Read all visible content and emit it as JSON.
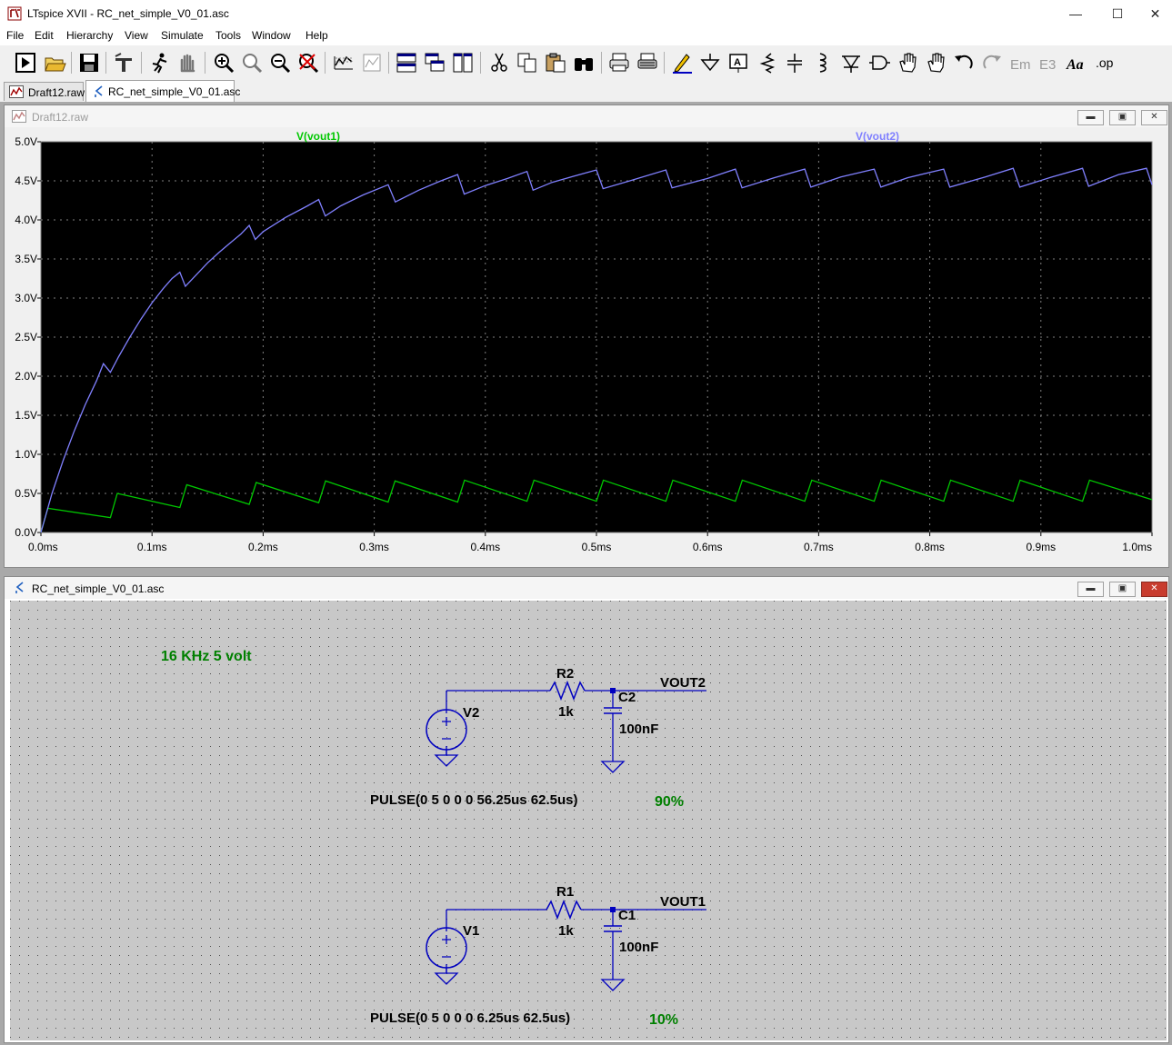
{
  "window": {
    "title": "LTspice XVII - RC_net_simple_V0_01.asc"
  },
  "menu": [
    "File",
    "Edit",
    "Hierarchy",
    "View",
    "Simulate",
    "Tools",
    "Window",
    "Help"
  ],
  "toolbar_icons": [
    "run-icon",
    "open-icon",
    "save-icon",
    "control-panel-icon",
    "run-man-icon",
    "halt-icon",
    "zoom-in-icon",
    "zoom-fit-icon",
    "zoom-out-icon",
    "zoom-cancel-icon",
    "autorange-icon",
    "pick-traces-icon",
    "tile-horizontal-icon",
    "cascade-icon",
    "tile-vertical-icon",
    "cut-icon",
    "copy-icon",
    "paste-icon",
    "find-icon",
    "print-icon",
    "print-setup-icon",
    "draw-wire-icon",
    "ground-icon",
    "label-net-icon",
    "resistor-icon",
    "capacitor-icon",
    "inductor-icon",
    "diode-icon",
    "component-icon",
    "move-icon",
    "drag-icon",
    "undo-icon",
    "redo-icon",
    "rotate-icon",
    "mirror-icon",
    "text-icon",
    "spice-directive-icon"
  ],
  "tabs": [
    {
      "label": "Draft12.raw",
      "icon": "waveform-icon"
    },
    {
      "label": "RC_net_simple_V0_01.asc",
      "icon": "schematic-icon"
    }
  ],
  "plot_window": {
    "title": "Draft12.raw"
  },
  "schematic_window": {
    "title": "RC_net_simple_V0_01.asc"
  },
  "colors": {
    "vout1": "#00c800",
    "vout2": "#8080ff",
    "schem_text": "#000000",
    "note_green": "#008000",
    "wire": "#0000c0"
  },
  "chart_data": {
    "type": "line",
    "title": "",
    "xlabel": "",
    "ylabel": "",
    "xlim": [
      0,
      1.0
    ],
    "ylim": [
      0,
      5.0
    ],
    "grid": true,
    "background": "#000000",
    "x_ticks": [
      "0.0ms",
      "0.1ms",
      "0.2ms",
      "0.3ms",
      "0.4ms",
      "0.5ms",
      "0.6ms",
      "0.7ms",
      "0.8ms",
      "0.9ms",
      "1.0ms"
    ],
    "y_ticks": [
      "0.0V",
      "0.5V",
      "1.0V",
      "1.5V",
      "2.0V",
      "2.5V",
      "3.0V",
      "3.5V",
      "4.0V",
      "4.5V",
      "5.0V"
    ],
    "series": [
      {
        "name": "V(vout1)",
        "color": "#00c800",
        "x": [
          0,
          0.00625,
          0.0625,
          0.06875,
          0.125,
          0.13125,
          0.1875,
          0.19375,
          0.25,
          0.25625,
          0.3125,
          0.31875,
          0.375,
          0.38125,
          0.4375,
          0.44375,
          0.5,
          0.50625,
          0.5625,
          0.56875,
          0.625,
          0.63125,
          0.6875,
          0.69375,
          0.75,
          0.75625,
          0.8125,
          0.81875,
          0.875,
          0.88125,
          0.9375,
          0.94375,
          1.0
        ],
        "y": [
          0,
          0.31,
          0.19,
          0.5,
          0.32,
          0.61,
          0.36,
          0.64,
          0.38,
          0.66,
          0.39,
          0.66,
          0.39,
          0.67,
          0.4,
          0.67,
          0.4,
          0.67,
          0.4,
          0.67,
          0.4,
          0.67,
          0.4,
          0.67,
          0.4,
          0.67,
          0.4,
          0.67,
          0.4,
          0.67,
          0.4,
          0.67,
          0.42
        ]
      },
      {
        "name": "V(vout2)",
        "color": "#8080ff",
        "x": [
          0,
          0.01,
          0.02,
          0.03,
          0.04,
          0.05,
          0.05625,
          0.0625,
          0.07,
          0.08,
          0.09,
          0.1,
          0.11,
          0.118,
          0.125,
          0.13,
          0.14,
          0.15,
          0.16,
          0.17,
          0.18,
          0.1875,
          0.193,
          0.2,
          0.22,
          0.24,
          0.25,
          0.256,
          0.27,
          0.29,
          0.3125,
          0.319,
          0.34,
          0.36,
          0.375,
          0.381,
          0.4,
          0.42,
          0.4375,
          0.443,
          0.46,
          0.48,
          0.5,
          0.506,
          0.53,
          0.5625,
          0.568,
          0.6,
          0.625,
          0.631,
          0.66,
          0.6875,
          0.693,
          0.72,
          0.75,
          0.756,
          0.78,
          0.8125,
          0.818,
          0.85,
          0.875,
          0.881,
          0.91,
          0.9375,
          0.943,
          0.97,
          0.995,
          1.0
        ],
        "y": [
          0,
          0.5,
          0.92,
          1.3,
          1.64,
          1.94,
          2.16,
          2.05,
          2.25,
          2.5,
          2.73,
          2.94,
          3.12,
          3.25,
          3.33,
          3.15,
          3.3,
          3.45,
          3.58,
          3.7,
          3.82,
          3.93,
          3.75,
          3.85,
          4.03,
          4.18,
          4.26,
          4.05,
          4.18,
          4.32,
          4.45,
          4.23,
          4.38,
          4.5,
          4.58,
          4.33,
          4.44,
          4.53,
          4.62,
          4.38,
          4.48,
          4.56,
          4.64,
          4.4,
          4.5,
          4.64,
          4.41,
          4.53,
          4.65,
          4.41,
          4.54,
          4.65,
          4.42,
          4.55,
          4.65,
          4.42,
          4.54,
          4.65,
          4.42,
          4.55,
          4.66,
          4.42,
          4.55,
          4.66,
          4.43,
          4.58,
          4.66,
          4.45
        ]
      }
    ]
  },
  "schematic": {
    "note": "16 KHz  5 volt",
    "circuit2": {
      "resistor_name": "R2",
      "resistor_value": "1k",
      "cap_name": "C2",
      "cap_value": "100nF",
      "source_name": "V2",
      "net_label": "VOUT2",
      "pulse": "PULSE(0 5 0 0 0 56.25us 62.5us)",
      "duty": "90%"
    },
    "circuit1": {
      "resistor_name": "R1",
      "resistor_value": "1k",
      "cap_name": "C1",
      "cap_value": "100nF",
      "source_name": "V1",
      "net_label": "VOUT1",
      "pulse": "PULSE(0 5 0 0 0 6.25us 62.5us)",
      "duty": "10%"
    }
  }
}
